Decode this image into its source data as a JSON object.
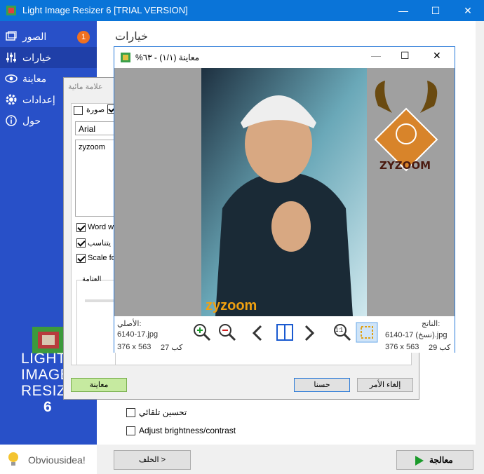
{
  "window": {
    "title": "Light Image Resizer 6  [TRIAL VERSION]",
    "minimize": "—",
    "maximize": "☐",
    "close": "✕"
  },
  "sidebar": {
    "items": [
      {
        "label": "الصور",
        "icon": "images-icon",
        "badge": "1"
      },
      {
        "label": "خيارات",
        "icon": "sliders-icon"
      },
      {
        "label": "معاينة",
        "icon": "eye-icon"
      },
      {
        "label": "إعدادات",
        "icon": "gear-icon"
      },
      {
        "label": "حول",
        "icon": "info-icon"
      }
    ],
    "brand": [
      "LIGHT",
      "IMAGE",
      "RESIZER",
      "6"
    ],
    "footer_logo": "Obviousidea!"
  },
  "main": {
    "title": "خيارات",
    "auto_enhance": "تحسين تلقائي",
    "brightness": "Adjust brightness/contrast",
    "back_button": "الخلف >",
    "process_button": "معالجة"
  },
  "watermark_dialog": {
    "title": "علامة مائية",
    "tab_image": "صورة",
    "font": "Arial",
    "text": "zyzoom",
    "word_wrap": "Word wr",
    "fit": "يتناسب",
    "scale": "Scale fo",
    "opacity": "العتامة",
    "preview_button": "معاينة",
    "ok_button": "حسنا",
    "cancel_button": "إلغاء الأمر"
  },
  "preview": {
    "title": "%معاينة (١/١) - ٦٣",
    "watermark_text": "zyzoom",
    "logo_text": "ZYZOOM",
    "original_label": "الأصلي:",
    "original_file": "6140-17.jpg",
    "original_dims": "376 x 563",
    "original_size": "كب 27",
    "result_label": "الناتج:",
    "result_file": "6140-17 (نسخ).jpg",
    "result_dims": "376 x 563",
    "result_size": "كب 29",
    "zoom_1to1": "1:1"
  }
}
